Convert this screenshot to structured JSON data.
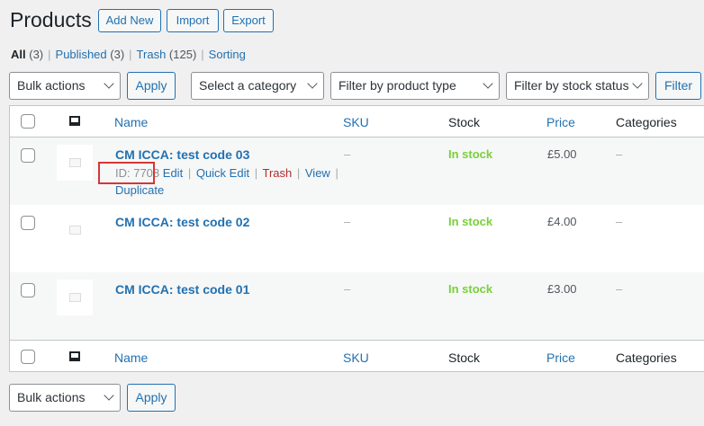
{
  "header": {
    "title": "Products",
    "add_new": "Add New",
    "import": "Import",
    "export": "Export"
  },
  "views": {
    "all_label": "All",
    "all_count": "(3)",
    "published_label": "Published",
    "published_count": "(3)",
    "trash_label": "Trash",
    "trash_count": "(125)",
    "sorting_label": "Sorting",
    "separator": "|"
  },
  "filters": {
    "bulk_actions": "Bulk actions",
    "apply": "Apply",
    "category": "Select a category",
    "product_type": "Filter by product type",
    "stock_status": "Filter by stock status",
    "filter_button": "Filter"
  },
  "columns": {
    "name": "Name",
    "sku": "SKU",
    "stock": "Stock",
    "price": "Price",
    "categories": "Categories"
  },
  "products": [
    {
      "name": "CM ICCA: test code 03",
      "sku": "–",
      "stock": "In stock",
      "price": "£5.00",
      "categories": "–",
      "id_text": "ID: 7708",
      "actions": {
        "edit": "Edit",
        "quick_edit": "Quick Edit",
        "trash": "Trash",
        "view": "View",
        "duplicate": "Duplicate",
        "sep": "|"
      }
    },
    {
      "name": "CM ICCA: test code 02",
      "sku": "–",
      "stock": "In stock",
      "price": "£4.00",
      "categories": "–"
    },
    {
      "name": "CM ICCA: test code 01",
      "sku": "–",
      "stock": "In stock",
      "price": "£3.00",
      "categories": "–"
    }
  ],
  "bottom": {
    "bulk_actions": "Bulk actions",
    "apply": "Apply"
  },
  "colors": {
    "link": "#2271b1",
    "in_stock": "#7ad03a",
    "trash": "#b32d2e",
    "highlight": "#d63638"
  }
}
